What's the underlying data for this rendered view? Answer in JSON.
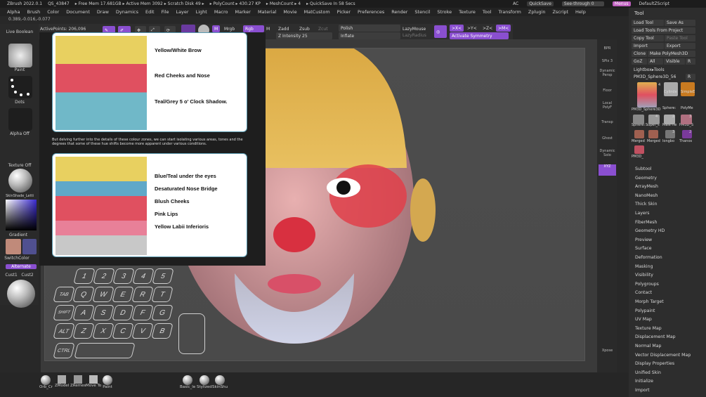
{
  "titlebar": {
    "items": [
      "ZBrush 2022.0.1",
      "QS_43847",
      "▸ Free Mem 17.681GB ▸ Active Mem 3092 ▸ Scratch Disk 49 ▸",
      "▸ PolyCount ▸ 430.27 KP",
      "▸ MeshCount ▸ 4",
      "▸ QuickSave In 58 Secs"
    ],
    "ac": "AC",
    "quicksave": "QuickSave",
    "seethrough": "See-through  0",
    "menus": "Menus",
    "zscript": "DefaultZScript"
  },
  "menubar": [
    "Alpha",
    "Brush",
    "Color",
    "Document",
    "Draw",
    "Dynamics",
    "Edit",
    "File",
    "Layer",
    "Light",
    "Macro",
    "Marker",
    "Material",
    "Movie",
    "MatCustom",
    "Picker",
    "Preferences",
    "Render",
    "Stencil",
    "Stroke",
    "Texture",
    "Tool",
    "Transform",
    "Zplugin",
    "Zscript",
    "Help"
  ],
  "coords": "0.389,-0.016,-0.077",
  "toolbar": {
    "active_points": "ActivePoints: 206,096",
    "m": "M",
    "mrgb": "Mrgb",
    "rgb": "Rgb",
    "zadd": "Zadd",
    "zsub": "Zsub",
    "zcut": "Zcut",
    "z_intensity": "Z Intensity 25",
    "polish": "Polish",
    "inflate": "Inflate",
    "lazymouse": "LazyMouse",
    "lazyradius": "LazyRadius",
    "x_btn": ">X<",
    "y_btn": ">Y<",
    "z_btn": ">Z<",
    "m_btn": ">M<",
    "activate_symmetry": "Activate Symmetry"
  },
  "leftshelf": {
    "live_boolean": "Live Boolean",
    "paint": "Paint",
    "dots": "Dots",
    "alpha_off": "Alpha Off",
    "texture_off": "Texture Off",
    "material": "SkinShade_Letti",
    "gradient": "Gradient",
    "switchcolor": "SwitchColor",
    "alternate": "Alternate",
    "cust1": "Cust1",
    "cust2": "Cust2"
  },
  "reference": {
    "card1_lines": [
      "Yellow/White Brow",
      "Red Cheeks and Nose",
      "Teal/Grey 5 o' Clock Shadow."
    ],
    "note": "But delving further into the details of these colour zones, we can start isolating various areas, tones and the degrees that some of these hue shifts become more apparent under various conditions.",
    "card2_lines": [
      "Blue/Teal under the eyes",
      "Desaturated Nose Bridge",
      "Blush Cheeks",
      "Pink Lips",
      "Yellow Labii Inferioris"
    ]
  },
  "rightshelf": [
    "BPR",
    "SPix 3",
    "Dynamic Persp",
    "Floor",
    "Local PolyF",
    "Transp",
    "Ghost",
    "Dynamic Solo",
    "XYZ",
    "Xpose"
  ],
  "toolpanel": {
    "title": "Tool",
    "load_tool": "Load Tool",
    "save_as": "Save As",
    "load_from_project": "Load Tools From Project",
    "copy_tool": "Copy Tool",
    "paste_tool": "Paste Tool",
    "import": "Import",
    "export": "Export",
    "clone": "Clone",
    "make_polymesh": "Make PolyMesh3D",
    "goz": "GoZ",
    "all": "All",
    "visible": "Visible",
    "r": "R",
    "lightbox": "Lightbox▸Tools",
    "current_tool": "PM3D_Sphere3D_56",
    "current_r": "R",
    "thumb_labels": [
      "PM3D_Sphere3D",
      "Cylinde",
      "SimpleE",
      "Sphere:",
      "PolyMe",
      "Sphere:",
      "Super_s",
      "Male He",
      "PM3D_S",
      "Merged",
      "Merged",
      "longbo",
      "Thanos",
      "PM3D_"
    ],
    "thumb_counts": [
      "4",
      "4",
      "2",
      "3",
      "3",
      "2"
    ],
    "subpalettes": [
      "Subtool",
      "Geometry",
      "ArrayMesh",
      "NanoMesh",
      "Thick Skin",
      "Layers",
      "FiberMesh",
      "Geometry HD",
      "Preview",
      "Surface",
      "Deformation",
      "Masking",
      "Visibility",
      "Polygroups",
      "Contact",
      "Morph Target",
      "Polypaint",
      "UV Map",
      "Texture Map",
      "Displacement Map",
      "Normal Map",
      "Vector Displacement Map",
      "Display Properties",
      "Unified Skin",
      "Initialize",
      "Import"
    ]
  },
  "keyboard": {
    "row1": [
      "1",
      "2",
      "3",
      "4",
      "5"
    ],
    "row2": [
      "TAB",
      "Q",
      "W",
      "E",
      "R",
      "T"
    ],
    "row3": [
      "SHIFT",
      "A",
      "S",
      "D",
      "F",
      "G"
    ],
    "row4": [
      "ALT",
      "Z",
      "X",
      "C",
      "V",
      "B"
    ],
    "row5": [
      "CTRL"
    ]
  },
  "bottomshelf": [
    "Orb_Cr",
    "ZModel",
    "ZRemes",
    "Move To",
    "Paint",
    "Basic_le",
    "Stylized",
    "SkinShu"
  ],
  "colors": {
    "accent": "#8a4fd0",
    "panel": "#2d2d2d",
    "background": "#282828"
  }
}
